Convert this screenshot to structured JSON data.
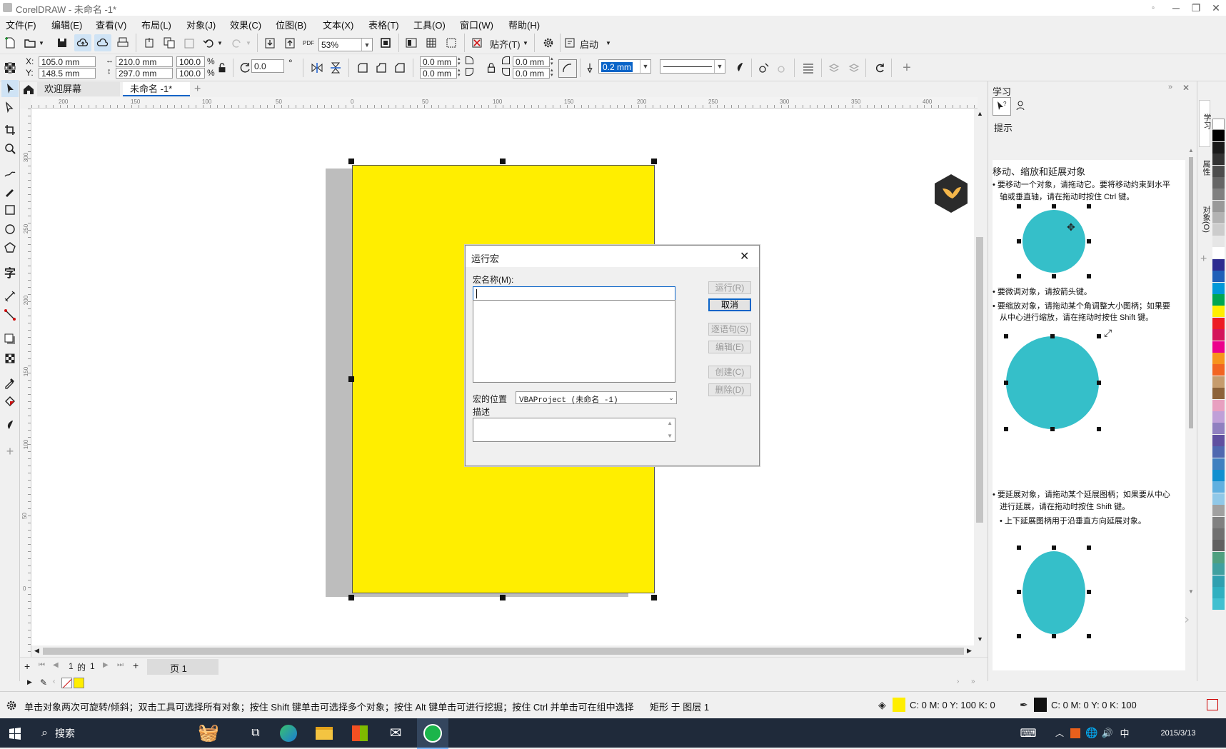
{
  "window": {
    "title": "CorelDRAW - 未命名 -1*"
  },
  "menu": [
    "文件(F)",
    "编辑(E)",
    "查看(V)",
    "布局(L)",
    "对象(J)",
    "效果(C)",
    "位图(B)",
    "文本(X)",
    "表格(T)",
    "工具(O)",
    "窗口(W)",
    "帮助(H)"
  ],
  "toolbar1": {
    "zoom": "53%",
    "snap_label": "贴齐(T)",
    "launch_label": "启动",
    "pdf_label": "PDF"
  },
  "toolbar2": {
    "x": "105.0 mm",
    "y": "148.5 mm",
    "width": "210.0 mm",
    "height": "297.0 mm",
    "scale_x": "100.0",
    "scale_y": "100.0",
    "pct1": "%",
    "pct2": "%",
    "rotation": "0.0",
    "degree": "°",
    "corner1": "0.0 mm",
    "corner2": "0.0 mm",
    "corner3": "0.0 mm",
    "corner4": "0.0 mm",
    "outline_width": "0.2 mm"
  },
  "tabs": {
    "welcome": "欢迎屏幕",
    "document": "未命名 -1*",
    "add": "+"
  },
  "ruler": {
    "h_ticks": [
      "200",
      "150",
      "100",
      "50",
      "0",
      "50",
      "100",
      "150",
      "200",
      "250",
      "300",
      "350",
      "400"
    ],
    "v_ticks": [
      "300",
      "250",
      "200",
      "150",
      "100",
      "50",
      "0"
    ]
  },
  "dialog": {
    "title": "运行宏",
    "macro_name_label": "宏名称(M):",
    "run": "运行(R)",
    "cancel": "取消",
    "step": "逐语句(S)",
    "edit": "编辑(E)",
    "create": "创建(C)",
    "delete": "删除(D)",
    "location_label": "宏的位置",
    "location_value": "VBAProject (未命名 -1)",
    "description_label": "描述"
  },
  "learn": {
    "panel_title": "学习",
    "hints_label": "提示",
    "heading": "移动、缩放和延展对象",
    "bullet1": "• 要移动一个对象，请拖动它。要将移动约束到水平",
    "bullet1b": "轴或垂直轴，请在拖动时按住 Ctrl 键。",
    "bullet2": "• 要微调对象，请按箭头键。",
    "bullet3": "• 要缩放对象，请拖动某个角调整大小图柄；如果要",
    "bullet3b": "从中心进行缩放，请在拖动时按住 Shift 键。",
    "bullet4": "• 要延展对象，请拖动某个延展图柄；如果要从中心",
    "bullet4b": "进行延展，请在拖动时按住 Shift 键。",
    "bullet5": "• 上下延展图柄用于沿垂直方向延展对象。",
    "circle_color": "#35bfc9"
  },
  "side_tabs": {
    "learn": "学习",
    "properties": "属性",
    "objects": "对象(O)"
  },
  "pagenav": {
    "current": "1",
    "of": "的",
    "total": "1",
    "page_tab": "页 1"
  },
  "status": {
    "hint": "单击对象两次可旋转/倾斜；双击工具可选择所有对象；按住 Shift 键单击可选择多个对象；按住 Alt 键单击可进行挖掘；按住 Ctrl 并单击可在组中选择",
    "object": "矩形 于 图层 1",
    "fill_cmyk": "C: 0 M: 0 Y: 100 K: 0",
    "outline_cmyk": "C: 0 M: 0 Y: 0 K: 100"
  },
  "taskbar": {
    "search": "搜索",
    "ime": "中",
    "date_partial": "2015/3/13"
  },
  "colors": {
    "page_fill": "#ffee00",
    "accent_blue": "#0a64c8",
    "palette": [
      "#ffffff",
      "#000000",
      "#1a1a1a",
      "#333333",
      "#4d4d4d",
      "#666666",
      "#808080",
      "#999999",
      "#b3b3b3",
      "#cccccc",
      "#e6e6e6",
      "#ffffff",
      "#2d2b8f",
      "#1f5fb8",
      "#0098d8",
      "#00a651",
      "#ffee00",
      "#ed1c24",
      "#d4145a",
      "#ec008c",
      "#f7941d",
      "#f26522",
      "#c69c6d",
      "#8c6239",
      "#e8a0c0",
      "#c0a0d8",
      "#9080c0",
      "#6050a0",
      "#5068b0",
      "#4080c0",
      "#1090d0",
      "#60b0e0",
      "#90c8e8",
      "#a0a0a0",
      "#808080",
      "#707070",
      "#606060",
      "#50a080",
      "#40a0a0",
      "#30a0b0",
      "#30b0c0",
      "#40c0d0"
    ]
  }
}
